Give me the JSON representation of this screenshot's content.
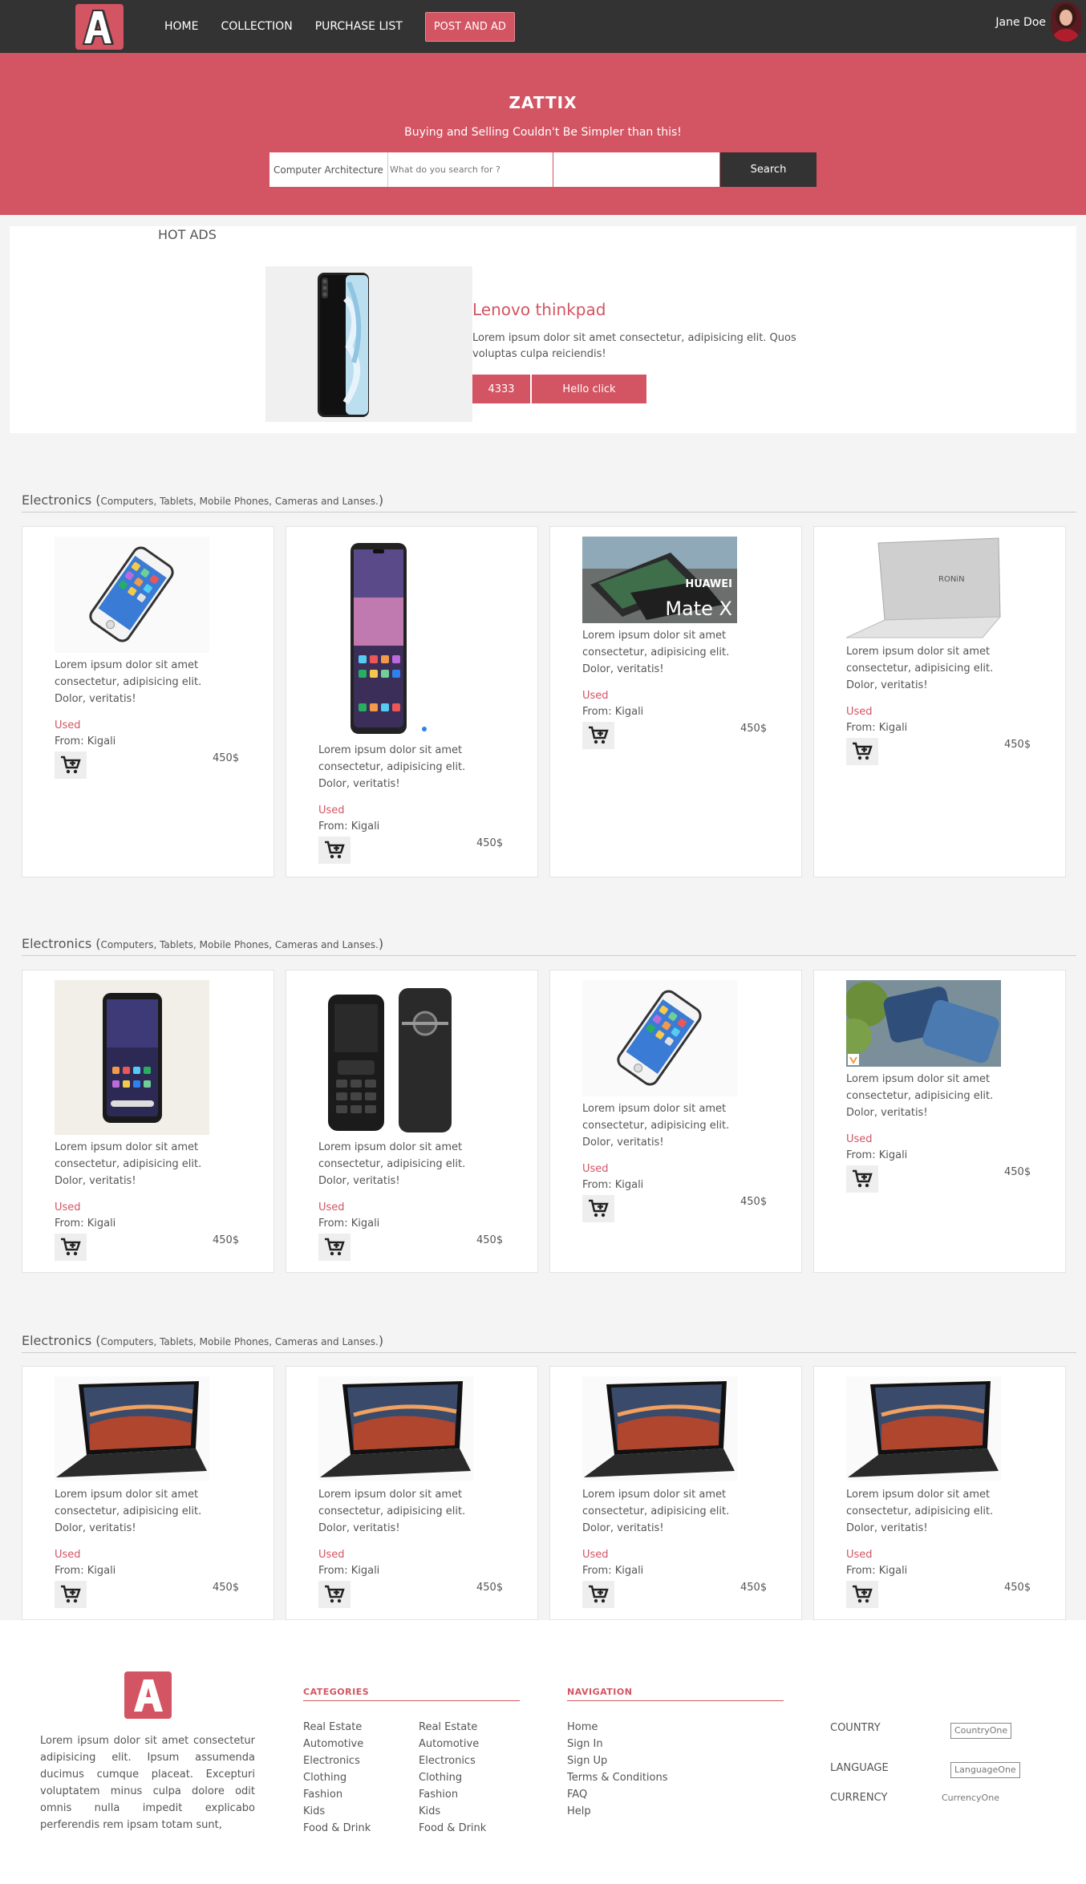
{
  "nav": {
    "links": [
      "HOME",
      "COLLECTION",
      "PURCHASE LIST"
    ],
    "post_label": "POST AND AD",
    "user_name": "Jane Doe"
  },
  "hero": {
    "title": "ZATTIX",
    "tagline": "Buying and Selling Couldn't Be Simpler than this!",
    "category": "Computer Architecture",
    "search_placeholder": "What do you search for ?",
    "search_label": "Search"
  },
  "hot": {
    "title": "HOT ADS",
    "name": "Lenovo thinkpad",
    "description": "Lorem ipsum dolor sit amet consectetur, adipisicing elit. Quos voluptas culpa reiciendis!",
    "button1": "4333",
    "button2": "Hello click"
  },
  "sections": [
    {
      "title": "Electronics",
      "subtitle": "Computers, Tablets, Mobile Phones, Cameras and Lanses.",
      "cards": [
        {
          "text": "Lorem ipsum dolor sit amet consectetur, adipisicing elit. Dolor, veritatis!",
          "condition": "Used",
          "from": "From: Kigali",
          "price": "450$"
        },
        {
          "text": "Lorem ipsum dolor sit amet consectetur, adipisicing elit. Dolor, veritatis!",
          "condition": "Used",
          "from": "From: Kigali",
          "price": "450$"
        },
        {
          "text": "Lorem ipsum dolor sit amet consectetur, adipisicing elit. Dolor, veritatis!",
          "condition": "Used",
          "from": "From: Kigali",
          "price": "450$",
          "image_caption_brand": "HUAWEI",
          "image_caption_model": "Mate X"
        },
        {
          "text": "Lorem ipsum dolor sit amet consectetur, adipisicing elit. Dolor, veritatis!",
          "condition": "Used",
          "from": "From: Kigali",
          "price": "450$"
        }
      ]
    },
    {
      "title": "Electronics",
      "subtitle": "Computers, Tablets, Mobile Phones, Cameras and Lanses.",
      "cards": [
        {
          "text": "Lorem ipsum dolor sit amet consectetur, adipisicing elit. Dolor, veritatis!",
          "condition": "Used",
          "from": "From: Kigali",
          "price": "450$"
        },
        {
          "text": "Lorem ipsum dolor sit amet consectetur, adipisicing elit. Dolor, veritatis!",
          "condition": "Used",
          "from": "From: Kigali",
          "price": "450$"
        },
        {
          "text": "Lorem ipsum dolor sit amet consectetur, adipisicing elit. Dolor, veritatis!",
          "condition": "Used",
          "from": "From: Kigali",
          "price": "450$"
        },
        {
          "text": "Lorem ipsum dolor sit amet consectetur, adipisicing elit. Dolor, veritatis!",
          "condition": "Used",
          "from": "From: Kigali",
          "price": "450$"
        }
      ]
    },
    {
      "title": "Electronics",
      "subtitle": "Computers, Tablets, Mobile Phones, Cameras and Lanses.",
      "cards": [
        {
          "text": "Lorem ipsum dolor sit amet consectetur, adipisicing elit. Dolor, veritatis!",
          "condition": "Used",
          "from": "From: Kigali",
          "price": "450$"
        },
        {
          "text": "Lorem ipsum dolor sit amet consectetur, adipisicing elit. Dolor, veritatis!",
          "condition": "Used",
          "from": "From: Kigali",
          "price": "450$"
        },
        {
          "text": "Lorem ipsum dolor sit amet consectetur, adipisicing elit. Dolor, veritatis!",
          "condition": "Used",
          "from": "From: Kigali",
          "price": "450$"
        },
        {
          "text": "Lorem ipsum dolor sit amet consectetur, adipisicing elit. Dolor, veritatis!",
          "condition": "Used",
          "from": "From: Kigali",
          "price": "450$"
        }
      ]
    }
  ],
  "footer": {
    "description": "Lorem ipsum dolor sit amet consectetur adipisicing elit. Ipsum assumenda ducimus cumque placeat. Excepturi voluptatem minus culpa dolore odit omnis nulla impedit explicabo perferendis rem ipsam totam sunt,",
    "categories_title": "CATEGORIES",
    "categories_col1": [
      "Real Estate",
      "Automotive",
      "Electronics",
      "Clothing",
      "Fashion",
      "Kids",
      "Food & Drink"
    ],
    "categories_col2": [
      "Real Estate",
      "Automotive",
      "Electronics",
      "Clothing",
      "Fashion",
      "Kids",
      "Food & Drink"
    ],
    "navigation_title": "NAVIGATION",
    "navigation": [
      "Home",
      "Sign In",
      "Sign Up",
      "Terms & Conditions",
      "FAQ",
      "Help"
    ],
    "country_label": "COUNTRY",
    "country_value": "CountryOne",
    "language_label": "LANGUAGE",
    "language_value": "LanguageOne",
    "currency_label": "CURRENCY",
    "currency_value": "CurrencyOne"
  },
  "colors": {
    "accent": "#d35462",
    "dark": "#333333"
  }
}
